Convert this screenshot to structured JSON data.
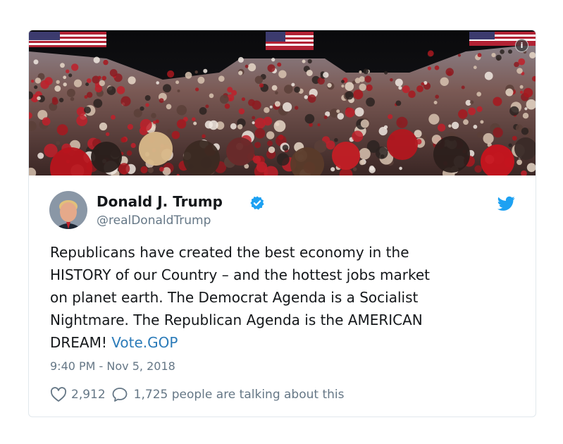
{
  "tweet": {
    "display_name": "Donald J. Trump",
    "handle": "@realDonaldTrump",
    "text_lines": [
      "Republicans have created the best economy in the",
      "HISTORY of our Country – and the hottest jobs market",
      "on planet earth. The Democrat Agenda is a Socialist",
      "Nightmare. The Republican Agenda is the AMERICAN",
      "DREAM!"
    ],
    "link_text": "Vote.GOP",
    "timestamp": "9:40 PM - Nov 5, 2018",
    "likes": "2,912",
    "talking": "1,725 people are talking about this"
  },
  "media": {
    "description_icon": "info-icon"
  },
  "colors": {
    "twitter_blue": "#1da1f2",
    "link": "#2b7bb9",
    "text": "#14171a",
    "secondary": "#657786",
    "border": "#e1e8ed"
  },
  "icons": {
    "verified": "verified-badge-icon",
    "brand": "twitter-bird-icon",
    "like": "heart-icon",
    "reply": "speech-bubble-icon"
  }
}
